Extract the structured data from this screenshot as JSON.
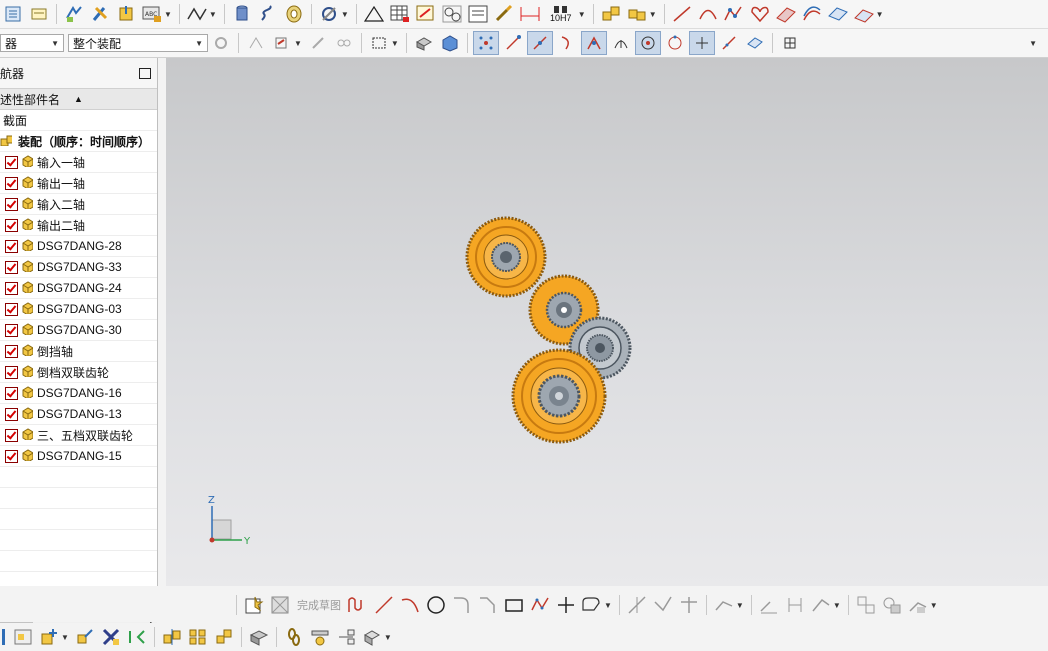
{
  "toolbar1": {
    "icons": [
      "window-icon",
      "note-icon",
      "assembly-move-icon",
      "tools-icon",
      "component-icon",
      "abc-annotation-icon",
      "surface-curve-icon",
      "cylinder-icon",
      "spring-icon",
      "cone-icon",
      "wire-icon",
      "triangle-icon",
      "table-grid-icon",
      "sketch-edit-icon",
      "analysis-icon",
      "notes-icon",
      "dimension-icon",
      "fit-tolerance-icon",
      "cube-pair-icon",
      "cube-group-icon",
      "curve-line-icon",
      "curve-arc-icon",
      "spline-icon",
      "heart-curve-icon",
      "sheet-icon",
      "offset-curve-icon",
      "surface-icon",
      "surface-blend-icon"
    ],
    "fit_label": "10H7"
  },
  "toolbar2": {
    "filter_value": "器",
    "assembly_scope_value": "整个装配"
  },
  "navigator": {
    "title": "导航器",
    "column_header": "描述性部件名",
    "items": [
      {
        "label": "截面",
        "type": "section",
        "checked": false
      },
      {
        "label": "装配（顺序：时间顺序）",
        "type": "root",
        "checked": false
      },
      {
        "label": "输入一轴",
        "type": "part",
        "checked": true
      },
      {
        "label": "输出一轴",
        "type": "part",
        "checked": true
      },
      {
        "label": "输入二轴",
        "type": "part",
        "checked": true
      },
      {
        "label": "输出二轴",
        "type": "part",
        "checked": true
      },
      {
        "label": "DSG7DANG-28",
        "type": "part",
        "checked": true
      },
      {
        "label": "DSG7DANG-33",
        "type": "part",
        "checked": true
      },
      {
        "label": "DSG7DANG-24",
        "type": "part",
        "checked": true
      },
      {
        "label": "DSG7DANG-03",
        "type": "part",
        "checked": true
      },
      {
        "label": "DSG7DANG-30",
        "type": "part",
        "checked": true
      },
      {
        "label": "倒挡轴",
        "type": "part",
        "checked": true
      },
      {
        "label": "倒档双联齿轮",
        "type": "part",
        "checked": true
      },
      {
        "label": "DSG7DANG-16",
        "type": "part",
        "checked": true
      },
      {
        "label": "DSG7DANG-13",
        "type": "part",
        "checked": true
      },
      {
        "label": "三、五档双联齿轮",
        "type": "part",
        "checked": true
      },
      {
        "label": "DSG7DANG-15",
        "type": "part",
        "checked": true
      }
    ]
  },
  "viewport": {
    "axis_z": "Z",
    "axis_y": "Y",
    "colors": {
      "gear_orange": "#f5a623",
      "gear_steel": "#9ea7b0",
      "bg_top": "#c7c8ca",
      "bg_bottom": "#e9e9eb"
    }
  },
  "sketch_toolbar": {
    "finish_sketch_label": "完成草图"
  }
}
